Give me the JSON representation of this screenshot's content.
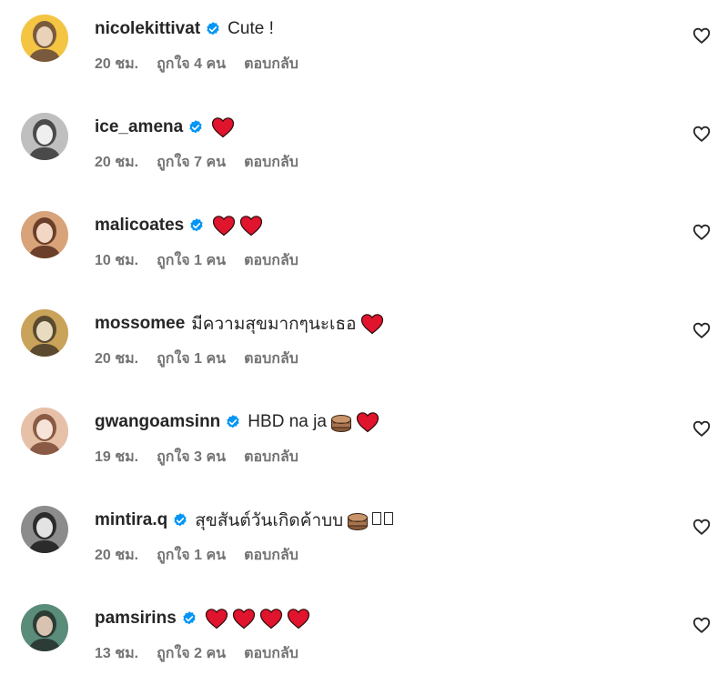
{
  "comments": [
    {
      "username": "nicolekittivat",
      "verified": true,
      "text": "Cute !",
      "emojis": [],
      "time": "20 ชม.",
      "likes": "ถูกใจ 4 คน",
      "reply": "ตอบกลับ"
    },
    {
      "username": "ice_amena",
      "verified": true,
      "text": "",
      "emojis": [
        "red-heart"
      ],
      "time": "20 ชม.",
      "likes": "ถูกใจ 7 คน",
      "reply": "ตอบกลับ"
    },
    {
      "username": "malicoates",
      "verified": true,
      "text": "",
      "emojis": [
        "red-heart",
        "red-heart"
      ],
      "time": "10 ชม.",
      "likes": "ถูกใจ 1 คน",
      "reply": "ตอบกลับ"
    },
    {
      "username": "mossomee",
      "verified": false,
      "text": "มีความสุขมากๆนะเธอ",
      "emojis": [
        "red-heart"
      ],
      "time": "20 ชม.",
      "likes": "ถูกใจ 1 คน",
      "reply": "ตอบกลับ"
    },
    {
      "username": "gwangoamsinn",
      "verified": true,
      "text": "HBD na ja",
      "emojis": [
        "birthday-cake",
        "red-heart"
      ],
      "time": "19 ชม.",
      "likes": "ถูกใจ 3 คน",
      "reply": "ตอบกลับ"
    },
    {
      "username": "mintira.q",
      "verified": true,
      "text": "สุขสันต์วันเกิดค้าบบ",
      "emojis": [
        "birthday-cake",
        "missing-glyph",
        "missing-glyph"
      ],
      "time": "20 ชม.",
      "likes": "ถูกใจ 1 คน",
      "reply": "ตอบกลับ"
    },
    {
      "username": "pamsirins",
      "verified": true,
      "text": "",
      "emojis": [
        "red-heart",
        "red-heart",
        "red-heart",
        "red-heart"
      ],
      "time": "13 ชม.",
      "likes": "ถูกใจ 2 คน",
      "reply": "ตอบกลับ"
    }
  ],
  "colors": {
    "text": "#262626",
    "meta": "#737373",
    "verified": "#0095f6",
    "heart": "#e0142d"
  },
  "icons": {
    "like": "heart-outline-icon",
    "verified": "verified-badge-icon"
  }
}
